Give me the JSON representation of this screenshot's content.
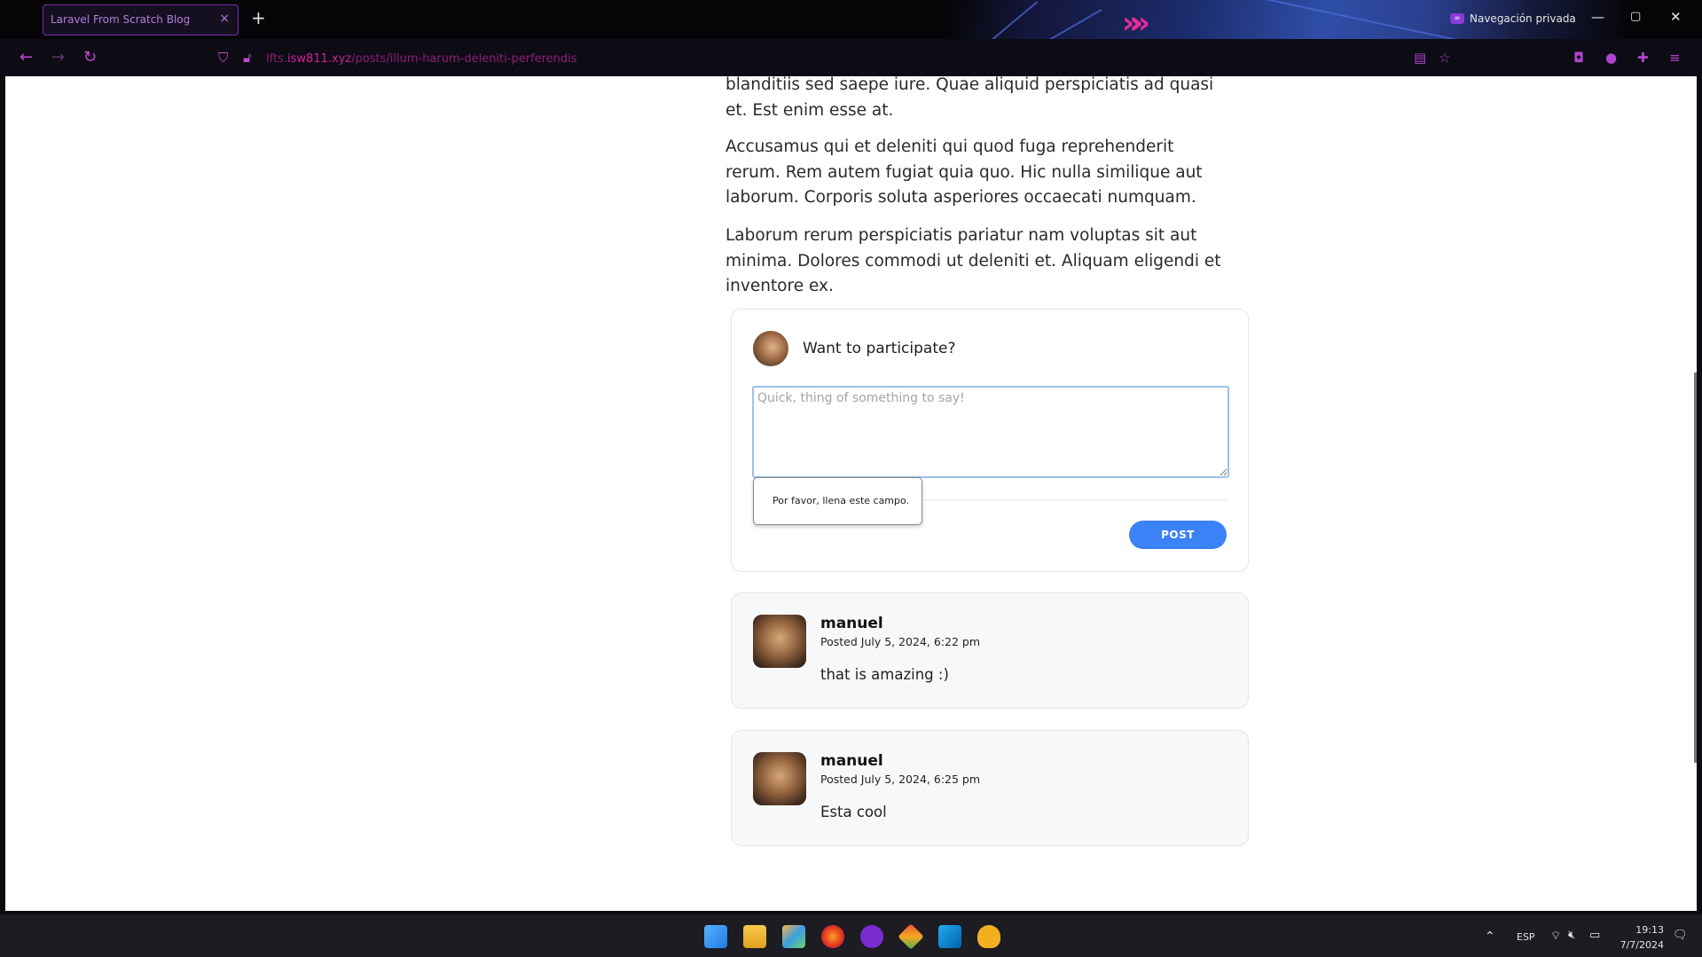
{
  "browser": {
    "tab_title": "Laravel From Scratch Blog",
    "tab_close": "×",
    "new_tab": "+",
    "private_label": "Navegación privada",
    "url_prefix": "lfts.",
    "url_host": "isw811.xyz",
    "url_path": "/posts/illum-harum-deleniti-perferendis"
  },
  "post": {
    "paragraphs": [
      "blanditiis sed saepe iure. Quae aliquid perspiciatis ad quasi et. Est enim esse at.",
      "Accusamus qui et deleniti qui quod fuga reprehenderit rerum. Rem autem fugiat quia quo. Hic nulla similique aut laborum. Corporis soluta asperiores occaecati numquam.",
      "Laborum rerum perspiciatis pariatur nam voluptas sit aut minima. Dolores commodi ut deleniti et. Aliquam eligendi et inventore ex."
    ]
  },
  "comment_form": {
    "prompt": "Want to participate?",
    "placeholder": "Quick, thing of something to say!",
    "value": "",
    "submit_label": "POST",
    "validation_tooltip": "Por favor, llena este campo."
  },
  "comments": [
    {
      "author": "manuel",
      "date": "Posted July 5, 2024, 6:22 pm",
      "body": "that is amazing :)"
    },
    {
      "author": "manuel",
      "date": "Posted July 5, 2024, 6:25 pm",
      "body": "Esta cool"
    }
  ],
  "taskbar": {
    "language": "ESP",
    "time": "19:13",
    "date": "7/7/2024"
  },
  "colors": {
    "accent_blue": "#3b82f6",
    "browser_accent": "#d0209a"
  }
}
